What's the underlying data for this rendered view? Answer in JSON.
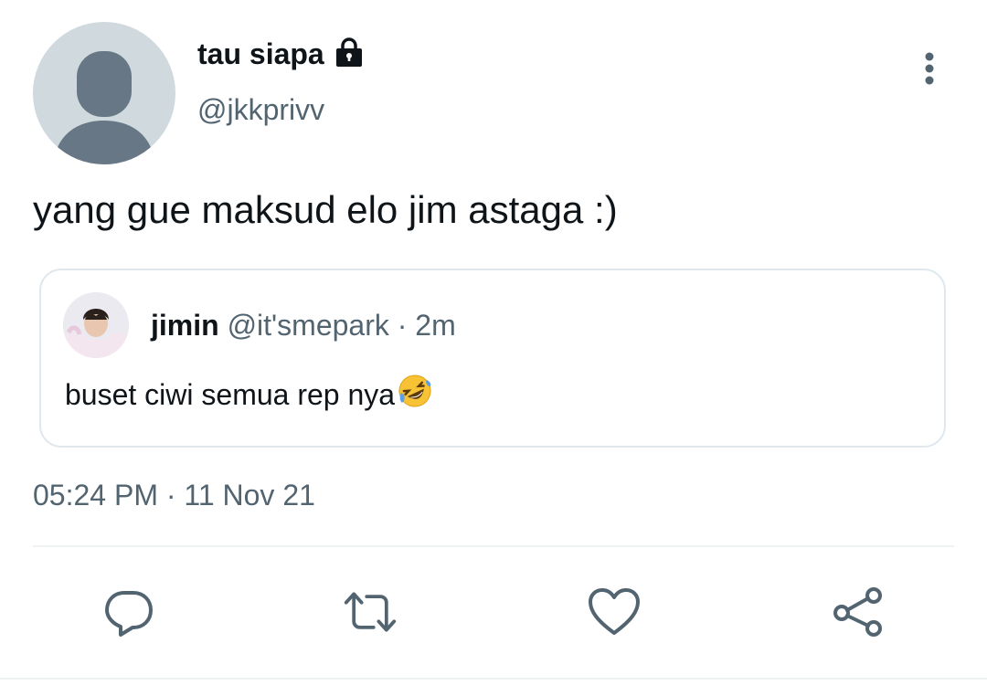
{
  "tweet": {
    "author": {
      "display_name": "tau siapa",
      "handle": "@jkkprivv",
      "protected_icon": "lock-icon"
    },
    "text": "yang gue maksud elo jim astaga :)",
    "timestamp": "05:24 PM",
    "date": "11 Nov 21",
    "separator": "·"
  },
  "quoted_tweet": {
    "display_name": "jimin",
    "handle": "@it'smepark",
    "separator": "·",
    "time": "2m",
    "text": "buset ciwi semua rep nya",
    "emoji": "rolling-on-floor-laughing-emoji"
  },
  "actions": [
    {
      "name": "reply",
      "icon": "reply-icon"
    },
    {
      "name": "retweet",
      "icon": "retweet-icon"
    },
    {
      "name": "like",
      "icon": "heart-icon"
    },
    {
      "name": "share",
      "icon": "share-icon"
    }
  ],
  "colors": {
    "text_primary": "#0f1419",
    "text_secondary": "#536471",
    "icon": "#536471",
    "border": "#e1e8ed",
    "avatar_bg": "#cfd9de",
    "avatar_fg": "#687785"
  }
}
